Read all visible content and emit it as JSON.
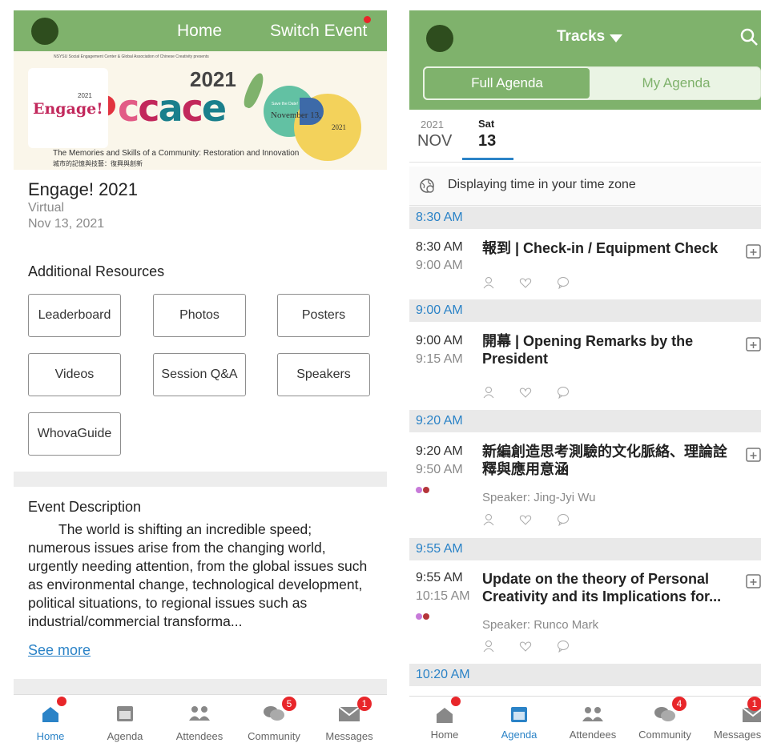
{
  "left": {
    "header": {
      "title": "Home",
      "switch_label": "Switch Event"
    },
    "banner": {
      "sponsors": "NSYSU Social Engagement Center  &  Global Association of Chinese Creativity  presents",
      "year": "2021",
      "logo_text": "Engage!",
      "logo_sup": "2021",
      "save_date": "Save the Date!",
      "date_month": "November 13,",
      "date_year": "2021",
      "subtitle_en": "The Memories and Skills of a Community: Restoration and Innovation",
      "subtitle_zh": "城市的記憶與技藝：復興與創新"
    },
    "event": {
      "title": "Engage! 2021",
      "venue": "Virtual",
      "date": "Nov 13, 2021"
    },
    "resources": {
      "title": "Additional Resources",
      "buttons": [
        "Leaderboard",
        "Photos",
        "Posters",
        "Videos",
        "Session Q&A",
        "Speakers",
        "WhovaGuide"
      ]
    },
    "description": {
      "title": "Event Description",
      "body": "The world is shifting an incredible speed; numerous issues arise from the changing world, urgently needing attention, from the global issues such as environmental change, technological development, political situations, to regional issues such as industrial/commercial transforma...",
      "see_more": "See more"
    },
    "tabs": [
      {
        "label": "Home",
        "active": true
      },
      {
        "label": "Agenda"
      },
      {
        "label": "Attendees"
      },
      {
        "label": "Community",
        "badge": "5"
      },
      {
        "label": "Messages",
        "badge": "1"
      }
    ]
  },
  "right": {
    "header": {
      "title": "Tracks",
      "full_agenda": "Full Agenda",
      "my_agenda": "My Agenda"
    },
    "date": {
      "year": "2021",
      "month": "NOV",
      "day_name": "Sat",
      "day_num": "13"
    },
    "timezone_text": "Displaying time in your time zone",
    "time_bands": [
      "8:30 AM",
      "9:00 AM",
      "9:20 AM",
      "9:55 AM",
      "10:20 AM"
    ],
    "sessions": [
      {
        "start": "8:30 AM",
        "end": "9:00 AM",
        "title": "報到 | Check-in / Equipment Check"
      },
      {
        "start": "9:00 AM",
        "end": "9:15 AM",
        "title": "開幕 | Opening Remarks by the President"
      },
      {
        "start": "9:20 AM",
        "end": "9:50 AM",
        "title": "新編創造思考測驗的文化脈絡、理論詮釋與應用意涵",
        "speaker": "Speaker: Jing-Jyi Wu"
      },
      {
        "start": "9:55 AM",
        "end": "10:15 AM",
        "title": "Update on the theory of Personal Creativity and its Implications for...",
        "speaker": "Speaker: Runco Mark"
      }
    ],
    "tabs": [
      {
        "label": "Home"
      },
      {
        "label": "Agenda",
        "active": true
      },
      {
        "label": "Attendees"
      },
      {
        "label": "Community",
        "badge": "4"
      },
      {
        "label": "Messages",
        "badge": "1"
      }
    ]
  },
  "colors": {
    "header_green": "#7fb26c",
    "accent_blue": "#2b83c7",
    "badge_red": "#e8262a"
  }
}
